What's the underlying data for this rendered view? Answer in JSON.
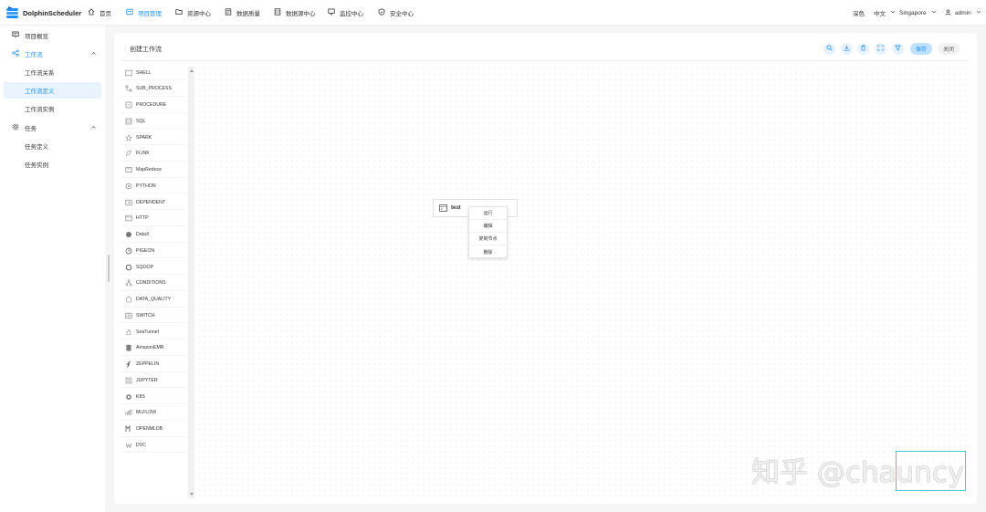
{
  "app": {
    "name": "DolphinScheduler",
    "brand_color": "#1890ff"
  },
  "nav": {
    "items": [
      {
        "label": "首页",
        "icon": "home-icon"
      },
      {
        "label": "项目管理",
        "icon": "folder-icon",
        "active": true
      },
      {
        "label": "资源中心",
        "icon": "folder-outline-icon"
      },
      {
        "label": "数据质量",
        "icon": "document-icon"
      },
      {
        "label": "数据源中心",
        "icon": "database-icon"
      },
      {
        "label": "监控中心",
        "icon": "monitor-icon"
      },
      {
        "label": "安全中心",
        "icon": "shield-icon"
      }
    ],
    "theme": "深色",
    "language": "中文",
    "timezone": "Singapore",
    "user": "admin"
  },
  "sidebar": {
    "overview": "项目概览",
    "workflow": "工作流",
    "workflow_items": [
      "工作流关系",
      "工作流定义",
      "工作流实例"
    ],
    "task": "任务",
    "task_items": [
      "任务定义",
      "任务实例"
    ]
  },
  "editor": {
    "title": "创建工作流",
    "save_label": "保存",
    "close_label": "关闭",
    "tasks": [
      "SHELL",
      "SUB_PROCESS",
      "PROCEDURE",
      "SQL",
      "SPARK",
      "FLINK",
      "MapReduce",
      "PYTHON",
      "DEPENDENT",
      "HTTP",
      "DataX",
      "PIGEON",
      "SQOOP",
      "CONDITIONS",
      "DATA_QUALITY",
      "SWITCH",
      "SeaTunnel",
      "AmazonEMR",
      "ZEPPELIN",
      "JUPYTER",
      "K8S",
      "MLFLOW",
      "OPENMLDB",
      "DVC"
    ],
    "node": {
      "name": "test"
    },
    "context_menu": [
      "运行",
      "编辑",
      "复制节点",
      "删除"
    ]
  },
  "watermark": "知乎 @chauncy"
}
